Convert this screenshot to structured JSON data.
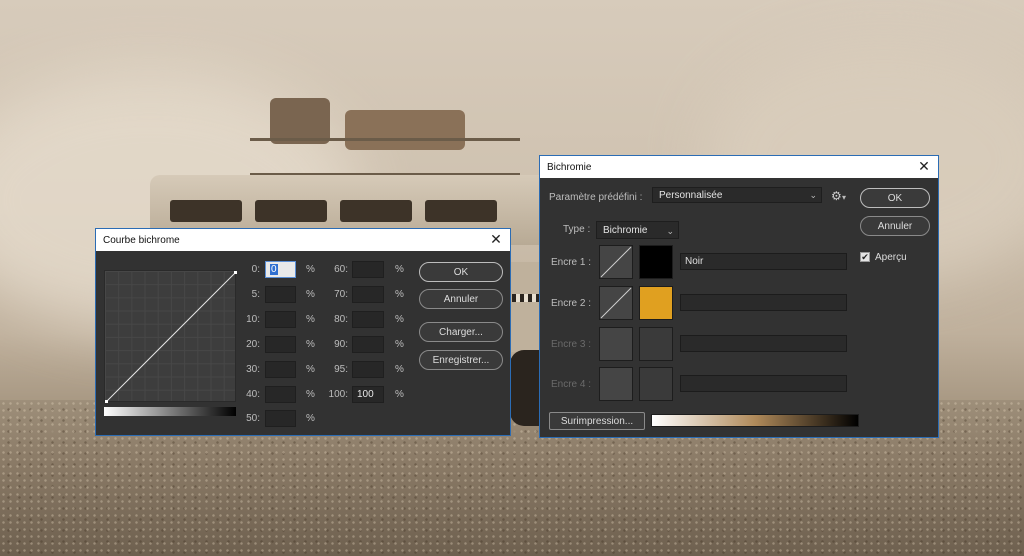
{
  "curve_dialog": {
    "title": "Courbe bichrome",
    "close_icon": "close-icon",
    "rows_left": [
      {
        "label": "0:",
        "value": "0",
        "unit": "%"
      },
      {
        "label": "5:",
        "value": "",
        "unit": "%"
      },
      {
        "label": "10:",
        "value": "",
        "unit": "%"
      },
      {
        "label": "20:",
        "value": "",
        "unit": "%"
      },
      {
        "label": "30:",
        "value": "",
        "unit": "%"
      },
      {
        "label": "40:",
        "value": "",
        "unit": "%"
      },
      {
        "label": "50:",
        "value": "",
        "unit": "%"
      }
    ],
    "rows_right": [
      {
        "label": "60:",
        "value": "",
        "unit": "%"
      },
      {
        "label": "70:",
        "value": "",
        "unit": "%"
      },
      {
        "label": "80:",
        "value": "",
        "unit": "%"
      },
      {
        "label": "90:",
        "value": "",
        "unit": "%"
      },
      {
        "label": "95:",
        "value": "",
        "unit": "%"
      },
      {
        "label": "100:",
        "value": "100",
        "unit": "%"
      }
    ],
    "buttons": {
      "ok": "OK",
      "cancel": "Annuler",
      "load": "Charger...",
      "save": "Enregistrer..."
    }
  },
  "duotone_dialog": {
    "title": "Bichromie",
    "close_icon": "close-icon",
    "preset_label": "Paramètre prédéfini :",
    "preset_value": "Personnalisée",
    "type_label": "Type :",
    "type_value": "Bichromie",
    "inks": [
      {
        "label": "Encre 1 :",
        "color": "#000000",
        "name": "Noir",
        "enabled": true
      },
      {
        "label": "Encre 2 :",
        "color": "#e0a020",
        "name": "",
        "enabled": true
      },
      {
        "label": "Encre 3 :",
        "color": "",
        "name": "",
        "enabled": false
      },
      {
        "label": "Encre 4 :",
        "color": "",
        "name": "",
        "enabled": false
      }
    ],
    "buttons": {
      "ok": "OK",
      "cancel": "Annuler",
      "overprint": "Surimpression..."
    },
    "preview_label": "Aperçu",
    "preview_checked": true,
    "gradient_colors": [
      "#ffffff",
      "#b08a5a",
      "#000000"
    ]
  }
}
